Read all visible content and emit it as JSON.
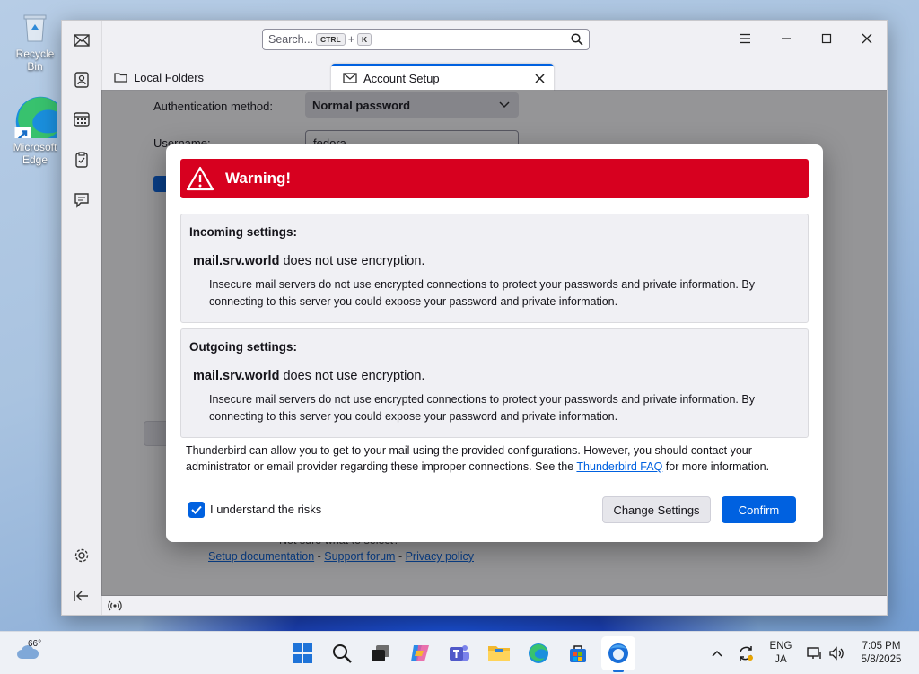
{
  "desktop": {
    "icons": [
      {
        "label": "Recycle Bin",
        "icon": "recycle-bin-icon"
      },
      {
        "label": "Microsoft Edge",
        "icon": "edge-icon"
      }
    ]
  },
  "window": {
    "search": {
      "placeholder": "Search...",
      "key1": "CTRL",
      "plus": "+",
      "key2": "K"
    },
    "tabs": [
      {
        "label": "Local Folders",
        "icon": "folder-icon"
      },
      {
        "label": "Account Setup",
        "icon": "mail-icon"
      }
    ],
    "background_form": {
      "auth_label": "Authentication method:",
      "auth_value": "Normal password",
      "username_label": "Username:",
      "username_value": "fedora",
      "links_prefix": "Not sure what to select?",
      "link_docs": "Setup documentation",
      "link_forum": "Support forum",
      "link_privacy": "Privacy policy",
      "sep": " - "
    }
  },
  "dialog": {
    "title": "Warning!",
    "incoming": {
      "heading": "Incoming settings:",
      "server": "mail.srv.world",
      "message": " does not use encryption.",
      "detail": "Insecure mail servers do not use encrypted connections to protect your passwords and private information. By connecting to this server you could expose your password and private information."
    },
    "outgoing": {
      "heading": "Outgoing settings:",
      "server": "mail.srv.world",
      "message": " does not use encryption.",
      "detail": "Insecure mail servers do not use encrypted connections to protect your passwords and private information. By connecting to this server you could expose your password and private information."
    },
    "note_before": "Thunderbird can allow you to get to your mail using the provided configurations. However, you should contact your administrator or email provider regarding these improper connections. See the ",
    "note_link": "Thunderbird FAQ",
    "note_after": " for more information.",
    "checkbox_label": "I understand the risks",
    "checkbox_checked": true,
    "change_button": "Change Settings",
    "confirm_button": "Confirm"
  },
  "taskbar": {
    "weather": "66°",
    "lang_top": "ENG",
    "lang_bottom": "JA",
    "time": "7:05 PM",
    "date": "5/8/2025"
  },
  "colors": {
    "accent": "#0061e0",
    "warning": "#d7001f"
  }
}
